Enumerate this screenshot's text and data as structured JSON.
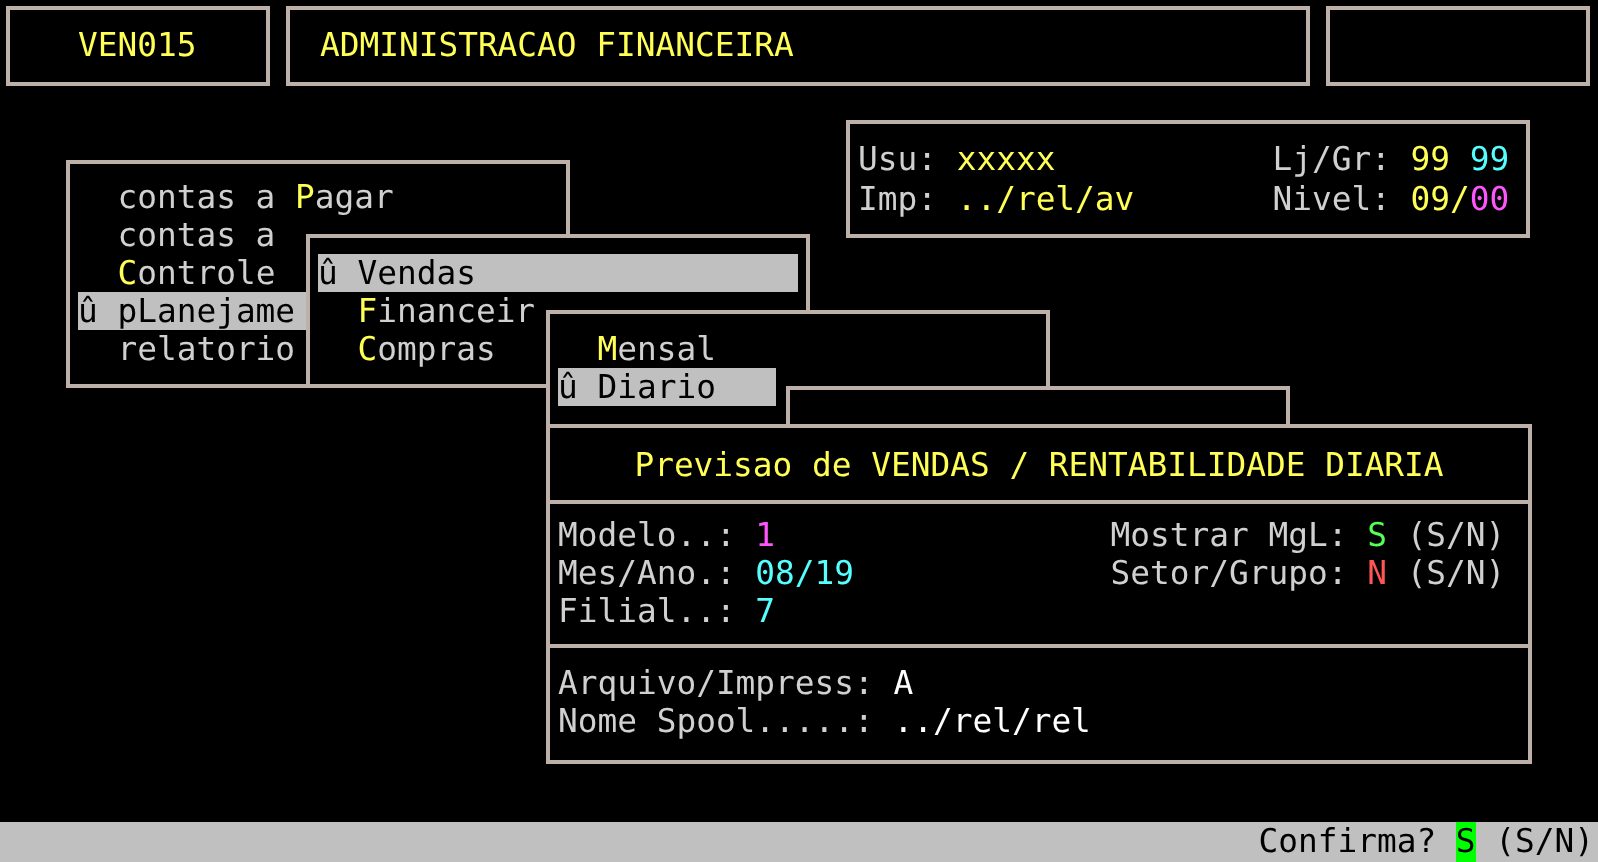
{
  "header": {
    "code": "VEN015",
    "title": "ADMINISTRACAO FINANCEIRA"
  },
  "session": {
    "user_label": "Usu:",
    "user": "xxxxx",
    "printer_label": "Imp:",
    "printer": "../rel/av",
    "store_group_label": "Lj/Gr:",
    "store_group": [
      {
        "text": "99",
        "color": "#ffff55"
      },
      {
        "text": "99",
        "color": "#55ffff"
      }
    ],
    "level_label": "Nivel:",
    "level_parts": [
      {
        "text": "09/",
        "color": "#ffff55"
      },
      {
        "text": "00",
        "color": "#ff55ff"
      }
    ]
  },
  "menus": [
    {
      "items": [
        {
          "before": "contas a ",
          "hotkey": "P",
          "after": "agar",
          "selected": false
        },
        {
          "before": "contas a",
          "selected": false
        },
        {
          "hotkey": "C",
          "after": "ontrole",
          "selected": false
        },
        {
          "before": "û pLanejame",
          "selected": true
        },
        {
          "before": "relatorio",
          "selected": false
        }
      ]
    },
    {
      "items": [
        {
          "before": "û Vendas",
          "selected": true
        },
        {
          "hotkey": "F",
          "after": "inanceir",
          "selected": false
        },
        {
          "hotkey": "C",
          "after": "ompras",
          "selected": false
        }
      ]
    },
    {
      "items": [
        {
          "hotkey": "M",
          "after": "ensal",
          "selected": false
        },
        {
          "before": "û Diario",
          "selected": true
        }
      ]
    }
  ],
  "dialog": {
    "title": "Previsao de VENDAS / RENTABILIDADE DIARIA",
    "fields": [
      {
        "label": "Modelo..:",
        "value": "1",
        "color": "#ff55ff"
      },
      {
        "label": "Mes/Ano.:",
        "value": "08/19",
        "color": "#55ffff"
      },
      {
        "label": "Filial..:",
        "value": "7",
        "color": "#55ffff"
      }
    ],
    "options": [
      {
        "label": "Mostrar MgL:",
        "value": "S",
        "color": "#55ff55",
        "hint": "(S/N)"
      },
      {
        "label": "Setor/Grupo:",
        "value": "N",
        "color": "#ff5555",
        "hint": "(S/N)"
      }
    ],
    "output": [
      {
        "label": "Arquivo/Impress:",
        "value": "A"
      },
      {
        "label": "Nome Spool.....:",
        "value": "../rel/rel"
      }
    ]
  },
  "status_bar": {
    "prompt": "Confirma?",
    "answer": "S",
    "hint": "(S/N)"
  }
}
